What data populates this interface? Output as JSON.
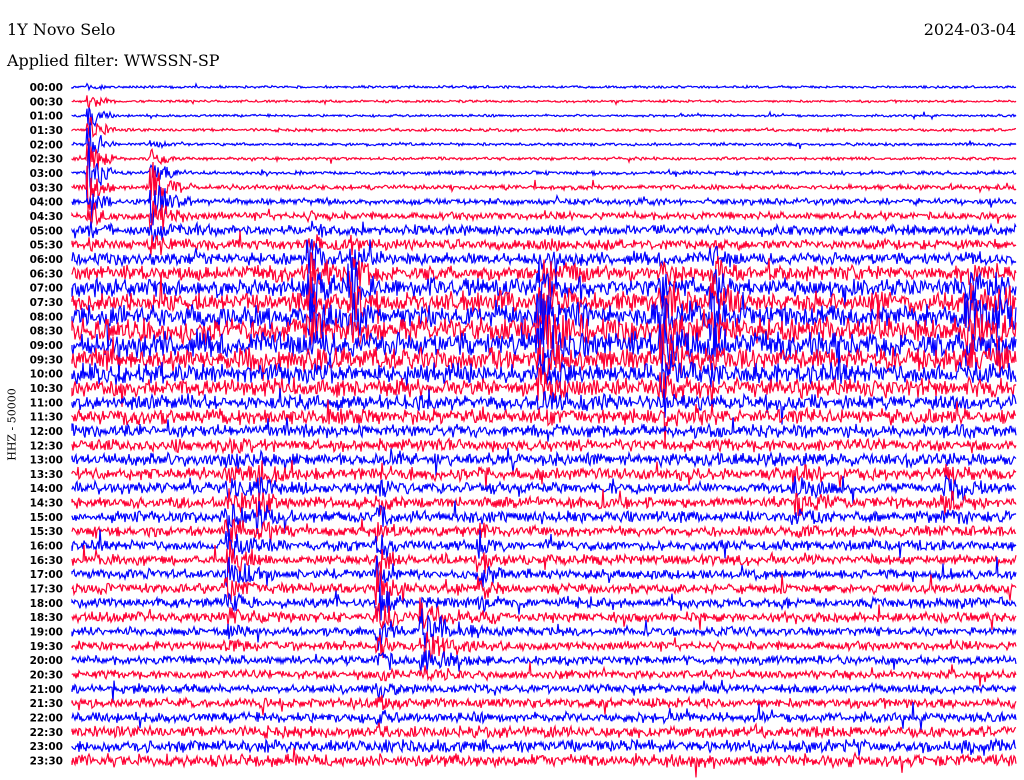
{
  "header": {
    "station": "1Y Novo Selo",
    "filter": "Applied filter: WWSSN-SP",
    "date": "2024-03-04"
  },
  "chart_data": {
    "type": "line",
    "title": "1Y Novo Selo",
    "ylabel": "HHZ - 50000",
    "minutes_per_line": 30,
    "row_labels": [
      "00:00",
      "00:30",
      "01:00",
      "01:30",
      "02:00",
      "02:30",
      "03:00",
      "03:30",
      "04:00",
      "04:30",
      "05:00",
      "05:30",
      "06:00",
      "06:30",
      "07:00",
      "07:30",
      "08:00",
      "08:30",
      "09:00",
      "09:30",
      "10:00",
      "10:30",
      "11:00",
      "11:30",
      "12:00",
      "12:30",
      "13:00",
      "13:30",
      "14:00",
      "14:30",
      "15:00",
      "15:30",
      "16:00",
      "16:30",
      "17:00",
      "17:30",
      "18:00",
      "18:30",
      "19:00",
      "19:30",
      "20:00",
      "20:30",
      "21:00",
      "21:30",
      "22:00",
      "22:30",
      "23:00",
      "23:30"
    ],
    "colors": [
      "#0000ff",
      "#ff0033"
    ],
    "background_noise_by_row": [
      1,
      1,
      1,
      1.2,
      1.2,
      1.2,
      1.5,
      2,
      2.5,
      3,
      4,
      4,
      5,
      6,
      7,
      8,
      9,
      10,
      10,
      9,
      8,
      7,
      6,
      6,
      5,
      5,
      5,
      5,
      4.5,
      4.5,
      4.5,
      4,
      4,
      4,
      4,
      4,
      4,
      4,
      3.5,
      3.5,
      3.5,
      3.5,
      3.5,
      4,
      4,
      4.5,
      5,
      5
    ],
    "events": [
      {
        "row_start": 0,
        "row_end": 11,
        "minute": 0.6,
        "amplitude": 40,
        "duration": 0.8
      },
      {
        "row_start": 4,
        "row_end": 12,
        "minute": 2.6,
        "amplitude": 30,
        "duration": 1.2
      },
      {
        "row_start": 9,
        "row_end": 19,
        "minute": 7.6,
        "amplitude": 35,
        "duration": 1.0
      },
      {
        "row_start": 10,
        "row_end": 18,
        "minute": 8.9,
        "amplitude": 30,
        "duration": 1.0
      },
      {
        "row_start": 11,
        "row_end": 23,
        "minute": 14.9,
        "amplitude": 45,
        "duration": 1.5
      },
      {
        "row_start": 12,
        "row_end": 23,
        "minute": 18.8,
        "amplitude": 35,
        "duration": 1.2
      },
      {
        "row_start": 11,
        "row_end": 20,
        "minute": 20.4,
        "amplitude": 30,
        "duration": 1.0
      },
      {
        "row_start": 12,
        "row_end": 21,
        "minute": 28.5,
        "amplitude": 30,
        "duration": 1.0
      },
      {
        "row_start": 13,
        "row_end": 19,
        "minute": 29.5,
        "amplitude": 25,
        "duration": 0.8
      },
      {
        "row_start": 24,
        "row_end": 40,
        "minute": 5.0,
        "amplitude": 22,
        "duration": 1.4
      },
      {
        "row_start": 26,
        "row_end": 32,
        "minute": 6.0,
        "amplitude": 20,
        "duration": 1.0
      },
      {
        "row_start": 25,
        "row_end": 46,
        "minute": 9.8,
        "amplitude": 26,
        "duration": 0.8
      },
      {
        "row_start": 36,
        "row_end": 41,
        "minute": 11.2,
        "amplitude": 30,
        "duration": 2.2
      },
      {
        "row_start": 29,
        "row_end": 38,
        "minute": 13.0,
        "amplitude": 18,
        "duration": 0.8
      },
      {
        "row_start": 26,
        "row_end": 31,
        "minute": 23.0,
        "amplitude": 18,
        "duration": 1.4
      },
      {
        "row_start": 26,
        "row_end": 31,
        "minute": 27.8,
        "amplitude": 20,
        "duration": 1.4
      }
    ]
  }
}
